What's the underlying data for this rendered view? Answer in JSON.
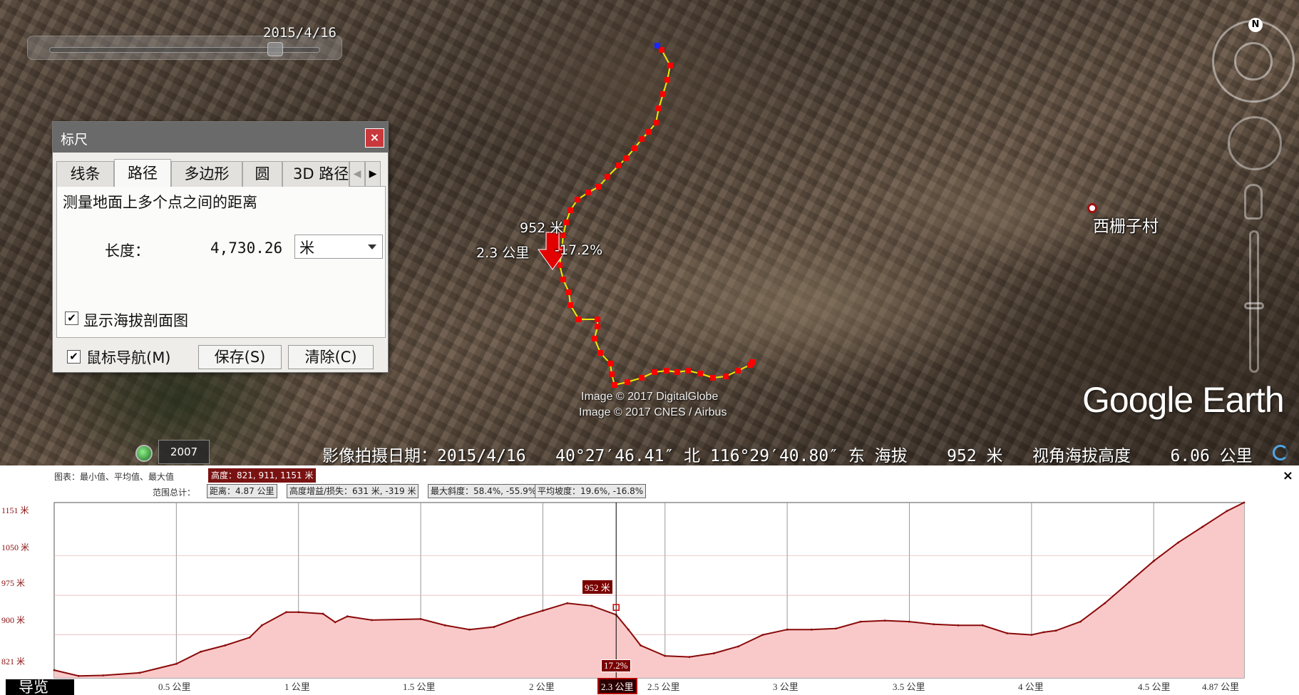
{
  "time_slider": {
    "date": "2015/4/16"
  },
  "map": {
    "marker_elevation": "952 米",
    "marker_distance": "2.3 公里",
    "marker_slope": "-17.2%",
    "village": "西栅子村",
    "credit_1": "Image © 2017 DigitalGlobe",
    "credit_2": "Image © 2017 CNES / Airbus",
    "logo": "Google Earth",
    "compass_n": "N",
    "history_year": "2007"
  },
  "status_bar": {
    "text": "影像拍摄日期：2015/4/16   40°27′46.41″ 北 116°29′40.80″ 东 海拔    952 米   视角海拔高度    6.06 公里"
  },
  "ruler": {
    "title": "标尺",
    "close": "×",
    "tabs": [
      "线条",
      "路径",
      "多边形",
      "圆",
      "3D 路径"
    ],
    "active_tab": "路径",
    "description": "测量地面上多个点之间的距离",
    "length_label": "长度：",
    "length_value": "4,730.26",
    "unit": "米",
    "show_profile_label": "显示海拔剖面图",
    "show_profile_checked": true,
    "mouse_nav_label": "鼠标导航(M)",
    "mouse_nav_checked": true,
    "save_button": "保存(S)",
    "clear_button": "清除(C)"
  },
  "profile": {
    "graph_label": "图表：最小值、平均值、最大值",
    "elevation_stat": "高度：821, 911, 1151 米",
    "range_label": "范围总计：",
    "distance_stat": "距离：4.87 公里",
    "gain_stat": "高度增益/损失：631 米, -319 米",
    "max_slope_stat": "最大斜度：58.4%, -55.9%",
    "avg_slope_stat": "平均坡度：19.6%, -16.8%",
    "close": "×",
    "guide_label": "导览",
    "cursor_elevation": "952 米",
    "cursor_slope": "17.2%",
    "y_labels": [
      "1151 米",
      "1050 米",
      "975 米",
      "900 米",
      "821 米"
    ],
    "x_labels": [
      "0.5 公里",
      "1 公里",
      "1.5 公里",
      "2 公里",
      "2.3 公里",
      "2.5 公里",
      "3 公里",
      "3.5 公里",
      "4 公里",
      "4.5 公里",
      "4.87 公里"
    ],
    "colors": {
      "line": "#8a0a0a",
      "fill": "#f9c9c9",
      "highlight": "#7a0000"
    }
  },
  "chart_data": {
    "type": "area",
    "x_unit": "公里",
    "y_unit": "米",
    "ylim": [
      821,
      1151
    ],
    "xlim": [
      0,
      4.87
    ],
    "x": [
      0,
      0.1,
      0.2,
      0.35,
      0.5,
      0.6,
      0.7,
      0.8,
      0.85,
      0.95,
      1.0,
      1.1,
      1.15,
      1.2,
      1.3,
      1.5,
      1.6,
      1.7,
      1.8,
      1.9,
      2.0,
      2.1,
      2.2,
      2.3,
      2.35,
      2.4,
      2.5,
      2.6,
      2.7,
      2.8,
      2.9,
      3.0,
      3.1,
      3.2,
      3.3,
      3.4,
      3.5,
      3.6,
      3.7,
      3.8,
      3.9,
      4.0,
      4.05,
      4.1,
      4.2,
      4.3,
      4.4,
      4.5,
      4.6,
      4.7,
      4.8,
      4.87
    ],
    "y": [
      833,
      822,
      823,
      828,
      845,
      868,
      880,
      895,
      918,
      943,
      943,
      940,
      924,
      935,
      928,
      930,
      918,
      910,
      915,
      932,
      946,
      960,
      955,
      938,
      910,
      880,
      860,
      858,
      865,
      878,
      900,
      910,
      910,
      912,
      925,
      927,
      925,
      920,
      918,
      918,
      903,
      900,
      905,
      908,
      925,
      960,
      1000,
      1040,
      1075,
      1105,
      1135,
      1151
    ]
  }
}
